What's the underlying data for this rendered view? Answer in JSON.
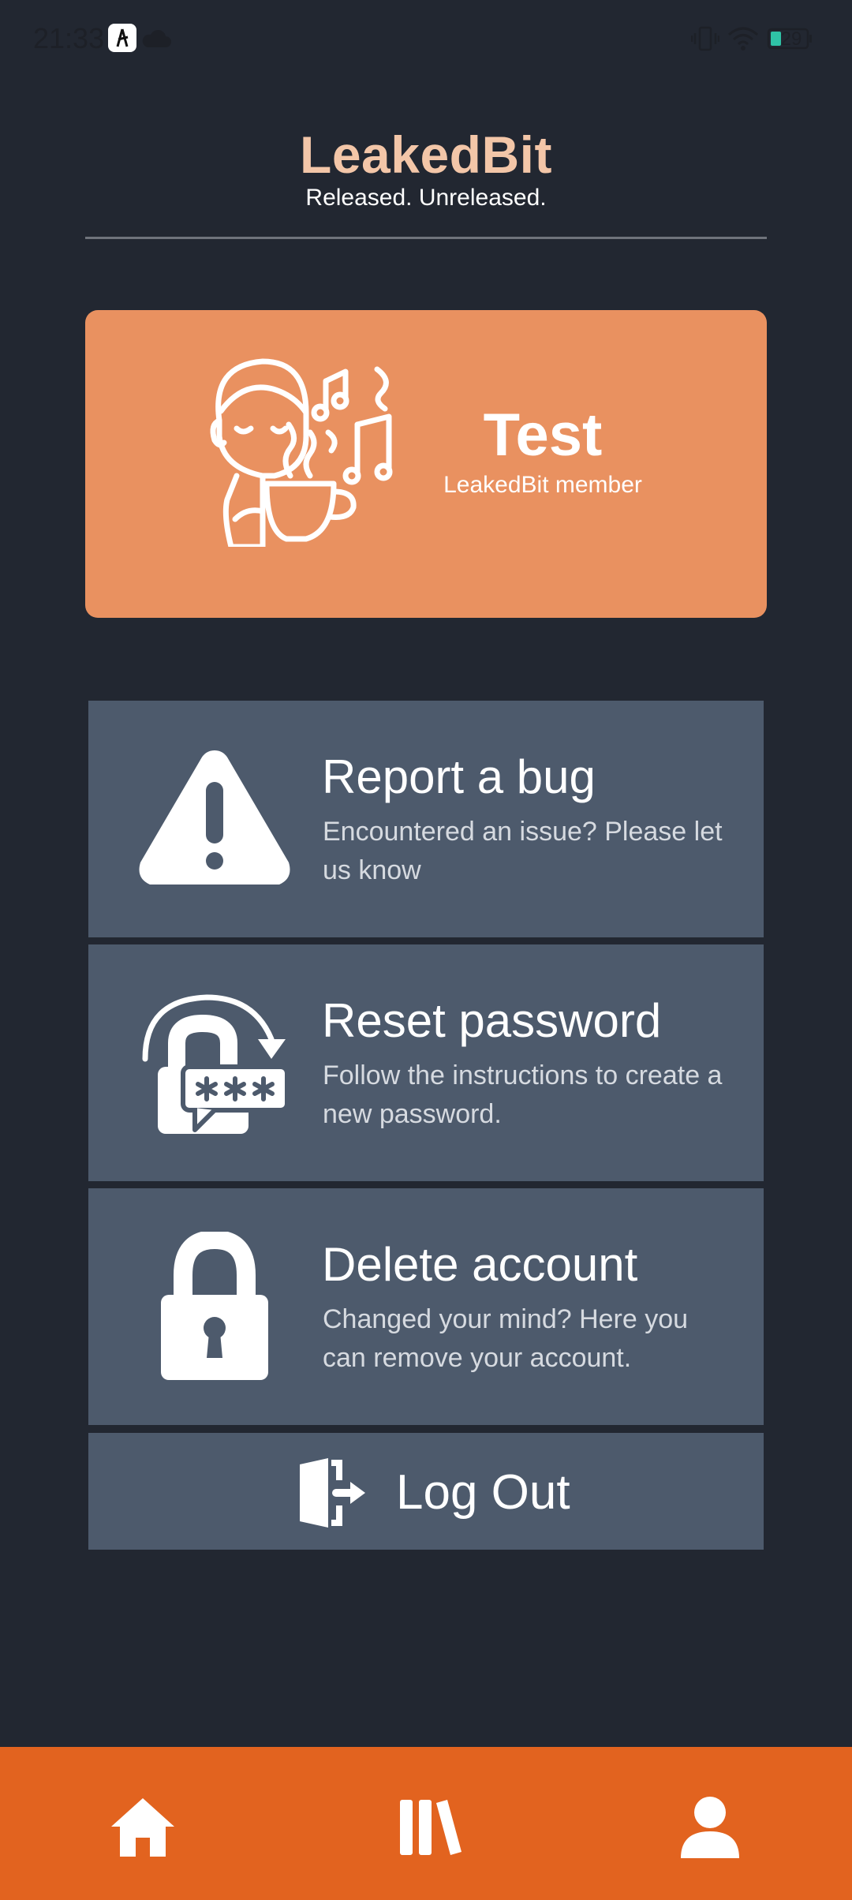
{
  "status_bar": {
    "time": "21:33",
    "battery": "29",
    "icons": [
      "app-notification-icon",
      "cloud-icon",
      "vibrate-icon",
      "wifi-icon",
      "battery-icon"
    ]
  },
  "header": {
    "title": "LeakedBit",
    "tagline": "Released. Unreleased."
  },
  "profile": {
    "name": "Test",
    "role": "LeakedBit member",
    "avatar_icon": "music-listener-avatar-icon"
  },
  "menu": [
    {
      "id": "report-bug",
      "title": "Report a bug",
      "description": "Encountered an issue? Please let us know",
      "icon": "warning-triangle-icon"
    },
    {
      "id": "reset-password",
      "title": "Reset password",
      "description": "Follow the instructions to create a new password.",
      "icon": "password-reset-lock-icon"
    },
    {
      "id": "delete-account",
      "title": "Delete account",
      "description": "Changed your mind? Here you can remove your account.",
      "icon": "padlock-icon"
    }
  ],
  "logout": {
    "label": "Log Out",
    "icon": "logout-door-icon"
  },
  "bottom_nav": [
    "home-icon",
    "library-icon",
    "profile-icon"
  ],
  "colors": {
    "background": "#222731",
    "accent": "#e99160",
    "nav_bar": "#e2631f",
    "card": "#4d5a6c",
    "title": "#f3c6a8"
  }
}
